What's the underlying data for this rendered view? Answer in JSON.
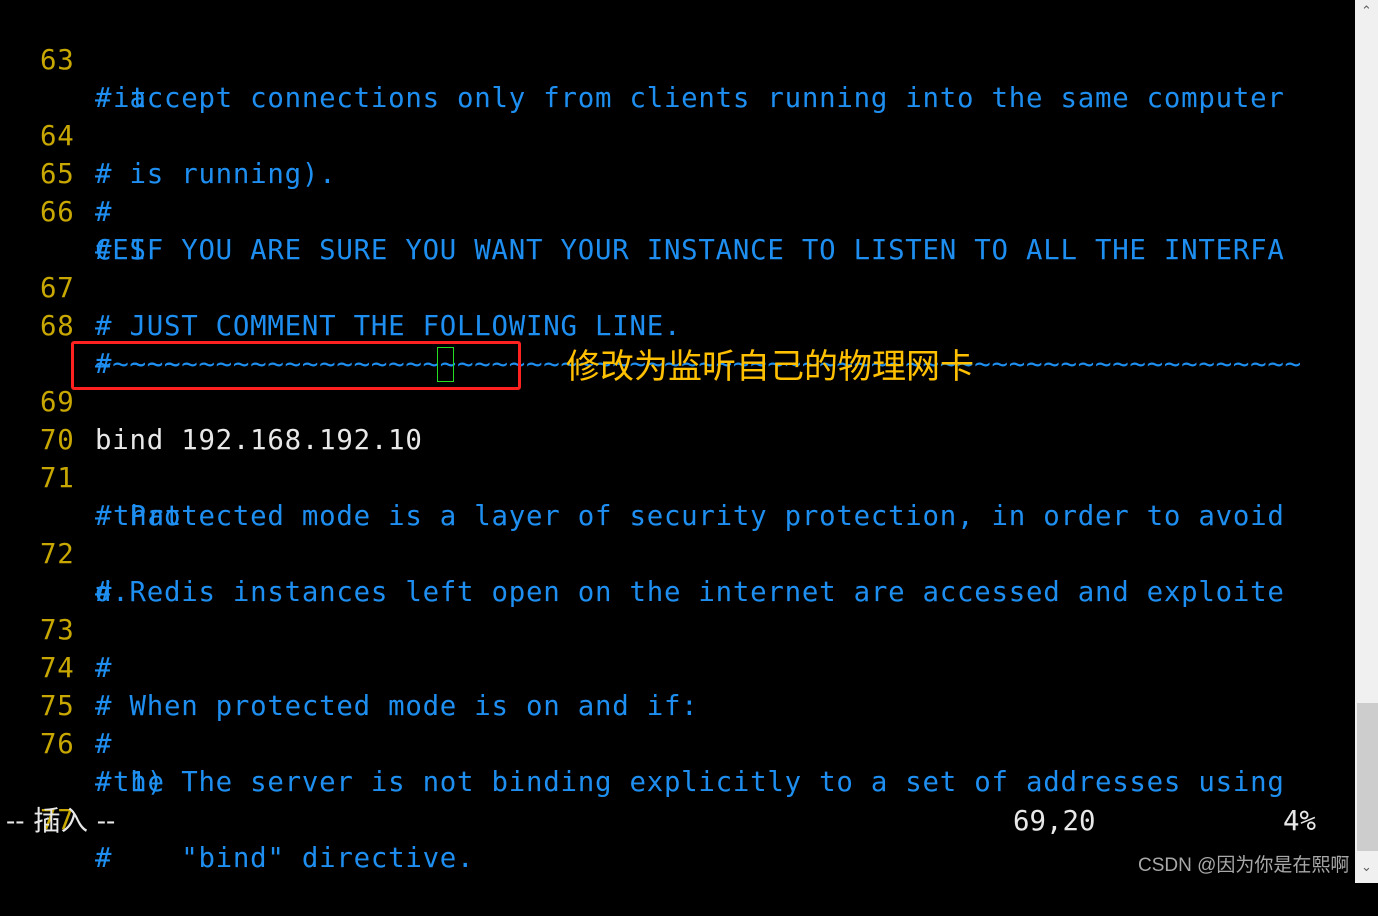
{
  "editor": {
    "lines": [
      {
        "num": "63",
        "text": "# accept connections only from clients running into the same computer",
        "wrap": "it"
      },
      {
        "num": "64",
        "text": "# is running)."
      },
      {
        "num": "65",
        "text": "#"
      },
      {
        "num": "66",
        "text": "# IF YOU ARE SURE YOU WANT YOUR INSTANCE TO LISTEN TO ALL THE INTERFA",
        "wrap": "CES"
      },
      {
        "num": "67",
        "text": "# JUST COMMENT THE FOLLOWING LINE."
      },
      {
        "num": "68",
        "text": "# ~~~~~~~~~~~~~~~~~~~~~~~~~~~~~~~~~~~~~~~~~~~~~~~~~~~~~~~~~~~~~~~~~~~~",
        "wrap": "~~~~~"
      },
      {
        "num": "69",
        "text": "bind 192.168.192.10"
      },
      {
        "num": "70",
        "text": ""
      },
      {
        "num": "71",
        "text": "# Protected mode is a layer of security protection, in order to avoid",
        "wrap": "that"
      },
      {
        "num": "72",
        "text": "# Redis instances left open on the internet are accessed and exploite",
        "wrap": "d."
      },
      {
        "num": "73",
        "text": "#"
      },
      {
        "num": "74",
        "text": "# When protected mode is on and if:"
      },
      {
        "num": "75",
        "text": "#"
      },
      {
        "num": "76",
        "text": "# 1) The server is not binding explicitly to a set of addresses using",
        "wrap": "the"
      },
      {
        "num": "77",
        "text": "#    \"bind\" directive."
      }
    ]
  },
  "annotation": {
    "text": "修改为监听自己的物理网卡"
  },
  "status_bar": {
    "mode": "-- 插入 --",
    "position": "69,20",
    "percent": "4%"
  },
  "watermark": {
    "text": "CSDN @因为你是在熙啊"
  },
  "scrollbar": {
    "up_arrow": "⌃",
    "down_arrow": "⌄",
    "position_fraction": 0.04
  },
  "colors": {
    "line_number": "#C8A800",
    "comment": "#1E8FF0",
    "text": "#E8E8E8",
    "highlight_box": "#FF2020",
    "annotation": "#FFC000",
    "cursor": "#22DD22"
  }
}
